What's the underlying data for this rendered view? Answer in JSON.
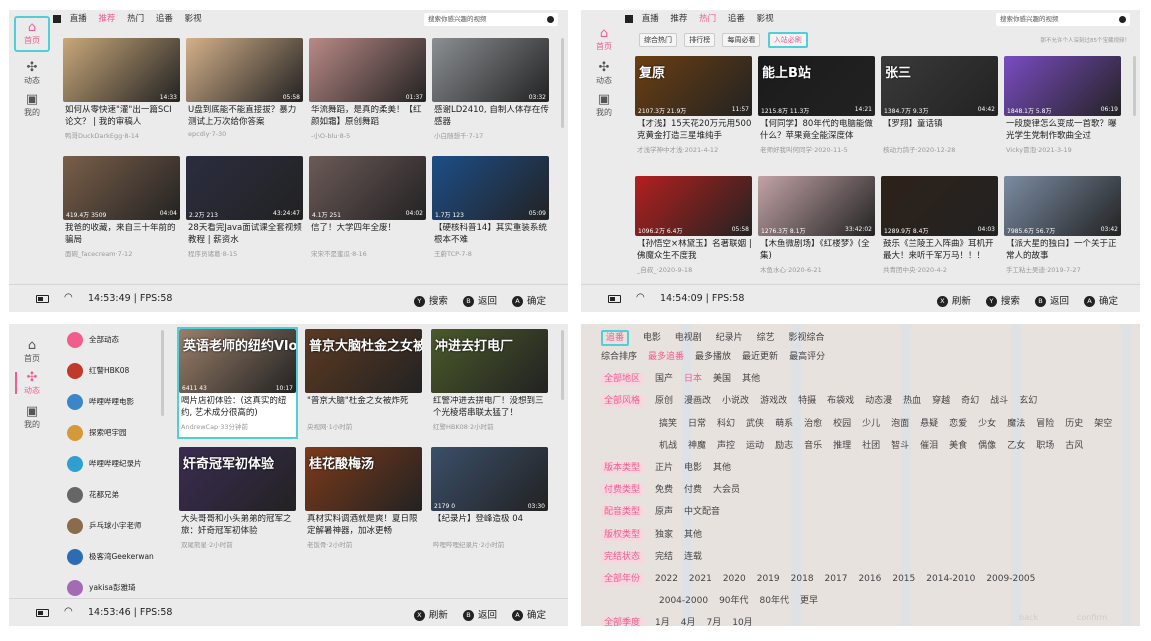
{
  "colors": {
    "accent": "#f25d8e",
    "focus": "#4fd0d8",
    "panel_bg": "#ebebeb"
  },
  "sidebar": {
    "home": "首页",
    "dynamic": "动态",
    "mine": "我的"
  },
  "top_tabs": [
    "直播",
    "推荐",
    "热门",
    "追番",
    "影视"
  ],
  "search_placeholder": "搜索你感兴趣的视频",
  "buttons": {
    "refresh": "刷新",
    "search": "搜索",
    "back": "返回",
    "confirm": "确定",
    "x": "X",
    "y": "Y",
    "b": "B",
    "a": "A"
  },
  "p1": {
    "time": "14:53:49 | FPS:58",
    "cards": [
      {
        "title": "如何从零快速\"灌\"出一篇SCI论文？ | 我的审稿人",
        "up": "鸭哥DuckDarkEgg·8-14",
        "stats": [
          "",
          "",
          "14:33"
        ],
        "bg": "#c9a87a"
      },
      {
        "title": "U盘到底能不能直接拔？暴力测试上万次给你答案",
        "up": "epcdiy·7-30",
        "stats": [
          "",
          "",
          "05:58"
        ],
        "bg": "#d4b18a"
      },
      {
        "title": "华流舞蹈，是真的柔美！【红颜如霜】原创舞蹈",
        "up": "-小O-blu·8-5",
        "stats": [
          "",
          "",
          "01:37"
        ],
        "bg": "#b98a86"
      },
      {
        "title": "感谢LD2410, 自制人体存在传感器",
        "up": "小白随想千·7-17",
        "stats": [
          "",
          "",
          "03:32"
        ],
        "bg": "#8b8f93"
      },
      {
        "title": "我爸的收藏，来自三十年前的骗局",
        "up": "面碗_facecream·7-12",
        "stats": [
          "419.4万",
          "3509",
          "04:04"
        ],
        "bg": "#7a5f4a"
      },
      {
        "title": "28天看完Java面试课全套视频教程 | 薪资水",
        "up": "程序员诸葛·8-15",
        "stats": [
          "2.2万",
          "213",
          "43:24:47"
        ],
        "bg": "#2b2d3f"
      },
      {
        "title": "信了！大学四年全废！",
        "up": "宋宋不是蜜瓜·8-16",
        "stats": [
          "4.1万",
          "251",
          "04:02"
        ],
        "bg": "#6c5a58"
      },
      {
        "title": "【硬核科普14】其实重装系统根本不难",
        "up": "王蔚TCP-7-8",
        "stats": [
          "1.7万",
          "123",
          "05:09"
        ],
        "bg": "#1d4e88"
      }
    ]
  },
  "p2": {
    "time": "14:54:09 | FPS:58",
    "subtabs": [
      "综合热门",
      "排行榜",
      "每周必看",
      "入站必刷"
    ],
    "note": "那不允许个人深刻过85个宝藏视频！",
    "cards": [
      {
        "title": "【才浅】15天花20万元用500克黄金打造三星堆纯手",
        "up": "才浅学神中才浅·2021-4-12",
        "stats": [
          "2107.3万",
          "21.9万",
          "11:57"
        ],
        "bg": "#6b3f12",
        "ovl": "复原"
      },
      {
        "title": "【何同学】80年代的电脑能做什么？苹果竟全能深度体",
        "up": "老师好我叫何同学·2020-11-5",
        "stats": [
          "1215.8万",
          "11.3万",
          "14:21"
        ],
        "bg": "#1b1b1b",
        "ovl": "能上B站"
      },
      {
        "title": "【罗翔】童话镇",
        "up": "核动力鸽子·2020-12-28",
        "stats": [
          "1384.7万",
          "9.3万",
          "04:42"
        ],
        "bg": "#3a3a3a",
        "ovl": "张三"
      },
      {
        "title": "一段旋律怎么变成一首歌？曝光学生党制作歌曲全过",
        "up": "Vicky冒泡·2021-3-19",
        "stats": [
          "1848.1万",
          "5.8万",
          "06:19"
        ],
        "bg": "#7a4cc2"
      },
      {
        "title": "【孙悟空×林黛玉】名著联姻 | 佛魔众生不度我",
        "up": "_自叔_·2020-9-18",
        "stats": [
          "1096.2万",
          "6.4万",
          "05:58"
        ],
        "bg": "#b3201f"
      },
      {
        "title": "【木鱼微剧场】《红楼梦》(全集)",
        "up": "木鱼水心·2020-6-21",
        "stats": [
          "1276.3万",
          "8.1万",
          "33:42:02"
        ],
        "bg": "#c2a3a6"
      },
      {
        "title": "鼓乐《兰陵王入阵曲》耳机开最大！来听千军万马！！！",
        "up": "共青团中央·2020-4-2",
        "stats": [
          "1289.9万",
          "8.4万",
          "04:03"
        ],
        "bg": "#2e2219"
      },
      {
        "title": "【派大星的独白】一个关于正常人的故事",
        "up": "手工粘土吴迪·2019-7-27",
        "stats": [
          "7985.6万",
          "56.7万",
          "03:42"
        ],
        "bg": "#7b8ca3"
      }
    ]
  },
  "p3": {
    "time": "14:53:46 | FPS:58",
    "uploaders": [
      "全部动态",
      "红警HBK08",
      "哔哩哔哩电影",
      "探索吧宇园",
      "哔哩哔哩纪录片",
      "花都兄弟",
      "乒乓球小宇老师",
      "极客湾Geekerwan",
      "yakisa彭雅琦"
    ],
    "cards": [
      {
        "title": "喝片店初体验：(这真实的纽约, 艺术成分很高的)",
        "up": "AndrewCap·33分钟前",
        "stats": [
          "6411",
          "43",
          "10:17"
        ],
        "bg": "#9a7f6a",
        "ovl": "英语老师的纽约Vlog"
      },
      {
        "title": "\"普京大脑\"杜金之女被炸死",
        "up": "央视网·1小时前",
        "stats": [
          "",
          "",
          ""
        ],
        "bg": "#5c3a22",
        "ovl": "普京大脑杜金之女被炸死"
      },
      {
        "title": "红警冲进去拼电厂！没想到三个光棱塔串联太猛了！",
        "up": "红警HBK08·2小时前",
        "stats": [
          "",
          "",
          ""
        ],
        "bg": "#4a5a2a",
        "ovl": "冲进去打电厂"
      },
      {
        "title": "大头哥哥和小头弟弟的冠军之旅：奸奇冠军初体验",
        "up": "双尾熊星·2小时前",
        "stats": [
          "",
          "",
          ""
        ],
        "bg": "#3b2c52",
        "ovl": "奸奇冠军初体验"
      },
      {
        "title": "真材实料调酒就是爽！夏日限定解暑神器，加冰更畅",
        "up": "老饭骨·2小时前",
        "stats": [
          "",
          "",
          ""
        ],
        "bg": "#7d3a1a",
        "ovl": "桂花酸梅汤"
      },
      {
        "title": "【纪录片】登峰造极 04",
        "up": "哔哩哔哩纪录片·2小时前",
        "stats": [
          "2179",
          "0",
          "03:30"
        ],
        "bg": "#3b4f6a",
        "ovl": ""
      }
    ]
  },
  "p4": {
    "main_tabs": [
      "追番",
      "电影",
      "电视剧",
      "纪录片",
      "综艺",
      "影视综合"
    ],
    "rows": [
      {
        "label": "",
        "items": [
          "综合排序",
          "最多追番",
          "最多播放",
          "最近更新",
          "最高评分"
        ]
      },
      {
        "label": "全部地区",
        "items": [
          "国产",
          "日本",
          "美国",
          "其他"
        ]
      },
      {
        "label": "全部风格",
        "items": [
          "原创",
          "漫画改",
          "小说改",
          "游戏改",
          "特摄",
          "布袋戏",
          "动态漫",
          "热血",
          "穿越",
          "奇幻",
          "战斗",
          "玄幻"
        ]
      },
      {
        "label": "",
        "items": [
          "搞笑",
          "日常",
          "科幻",
          "武侠",
          "萌系",
          "治愈",
          "校园",
          "少儿",
          "泡面",
          "悬疑",
          "恋爱",
          "少女",
          "魔法",
          "冒险",
          "历史",
          "架空"
        ]
      },
      {
        "label": "",
        "items": [
          "机战",
          "神魔",
          "声控",
          "运动",
          "励志",
          "音乐",
          "推理",
          "社团",
          "智斗",
          "催泪",
          "美食",
          "偶像",
          "乙女",
          "职场",
          "古风"
        ]
      },
      {
        "label": "版本类型",
        "items": [
          "正片",
          "电影",
          "其他"
        ]
      },
      {
        "label": "付费类型",
        "items": [
          "免费",
          "付费",
          "大会员"
        ]
      },
      {
        "label": "配音类型",
        "items": [
          "原声",
          "中文配音"
        ]
      },
      {
        "label": "版权类型",
        "items": [
          "独家",
          "其他"
        ]
      },
      {
        "label": "完结状态",
        "items": [
          "完结",
          "连载"
        ]
      },
      {
        "label": "全部年份",
        "items": [
          "2022",
          "2021",
          "2020",
          "2019",
          "2018",
          "2017",
          "2016",
          "2015",
          "2014-2010",
          "2009-2005"
        ]
      },
      {
        "label": "",
        "items": [
          "2004-2000",
          "90年代",
          "80年代",
          "更早"
        ]
      },
      {
        "label": "全部季度",
        "items": [
          "1月",
          "4月",
          "7月",
          "10月"
        ]
      }
    ],
    "ghost": [
      "back",
      "confirm"
    ]
  }
}
